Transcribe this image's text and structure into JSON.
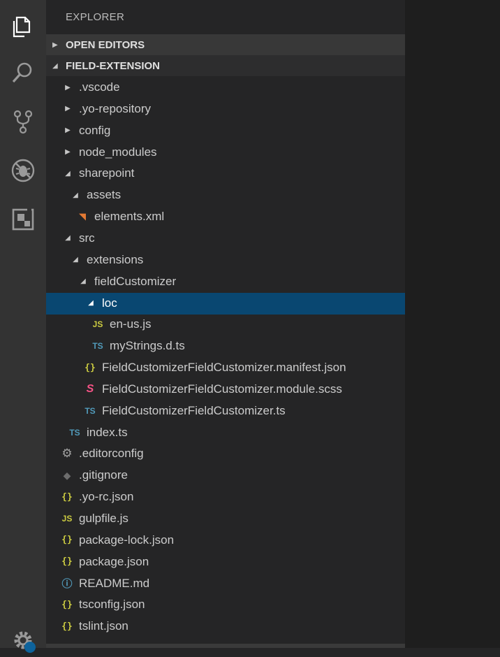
{
  "explorer": {
    "title": "EXPLORER"
  },
  "sections": {
    "open_editors": {
      "label": "OPEN EDITORS",
      "expanded": false
    },
    "project": {
      "label": "FIELD-EXTENSION",
      "expanded": true
    }
  },
  "tree": [
    {
      "label": ".vscode",
      "depth": 0,
      "kind": "folder",
      "expanded": false
    },
    {
      "label": ".yo-repository",
      "depth": 0,
      "kind": "folder",
      "expanded": false
    },
    {
      "label": "config",
      "depth": 0,
      "kind": "folder",
      "expanded": false
    },
    {
      "label": "node_modules",
      "depth": 0,
      "kind": "folder",
      "expanded": false
    },
    {
      "label": "sharepoint",
      "depth": 0,
      "kind": "folder",
      "expanded": true
    },
    {
      "label": "assets",
      "depth": 1,
      "kind": "folder",
      "expanded": true
    },
    {
      "label": "elements.xml",
      "depth": 2,
      "kind": "file",
      "icon": "rss-icon"
    },
    {
      "label": "src",
      "depth": 0,
      "kind": "folder",
      "expanded": true
    },
    {
      "label": "extensions",
      "depth": 1,
      "kind": "folder",
      "expanded": true
    },
    {
      "label": "fieldCustomizer",
      "depth": 2,
      "kind": "folder",
      "expanded": true
    },
    {
      "label": "loc",
      "depth": 3,
      "kind": "folder",
      "expanded": true,
      "selected": true
    },
    {
      "label": "en-us.js",
      "depth": 4,
      "kind": "file",
      "icon": "js-icon"
    },
    {
      "label": "myStrings.d.ts",
      "depth": 4,
      "kind": "file",
      "icon": "ts-icon"
    },
    {
      "label": "FieldCustomizerFieldCustomizer.manifest.json",
      "depth": 3,
      "kind": "file",
      "icon": "json-icon"
    },
    {
      "label": "FieldCustomizerFieldCustomizer.module.scss",
      "depth": 3,
      "kind": "file",
      "icon": "sass-icon"
    },
    {
      "label": "FieldCustomizerFieldCustomizer.ts",
      "depth": 3,
      "kind": "file",
      "icon": "ts-icon"
    },
    {
      "label": "index.ts",
      "depth": 1,
      "kind": "file",
      "icon": "ts-icon"
    },
    {
      "label": ".editorconfig",
      "depth": 0,
      "kind": "file",
      "icon": "gear-icon"
    },
    {
      "label": ".gitignore",
      "depth": 0,
      "kind": "file",
      "icon": "git-icon"
    },
    {
      "label": ".yo-rc.json",
      "depth": 0,
      "kind": "file",
      "icon": "json-icon"
    },
    {
      "label": "gulpfile.js",
      "depth": 0,
      "kind": "file",
      "icon": "js-icon"
    },
    {
      "label": "package-lock.json",
      "depth": 0,
      "kind": "file",
      "icon": "json-icon"
    },
    {
      "label": "package.json",
      "depth": 0,
      "kind": "file",
      "icon": "json-icon"
    },
    {
      "label": "README.md",
      "depth": 0,
      "kind": "file",
      "icon": "info-icon"
    },
    {
      "label": "tsconfig.json",
      "depth": 0,
      "kind": "file",
      "icon": "json-icon"
    },
    {
      "label": "tslint.json",
      "depth": 0,
      "kind": "file",
      "icon": "json-icon"
    }
  ],
  "icon_glyphs": {
    "js-icon": "JS",
    "ts-icon": "TS",
    "json-icon": "{}",
    "rss-icon": "◥",
    "sass-icon": "S",
    "gear-icon": "⚙",
    "git-icon": "◆",
    "info-icon": "ⓘ"
  },
  "activity_bar": [
    "explorer-icon",
    "search-icon",
    "source-control-icon",
    "debug-icon",
    "extensions-icon",
    "settings-icon"
  ],
  "colors": {
    "activity_bar_bg": "#333333",
    "sidebar_bg": "#252526",
    "selection_bg": "#094771",
    "section_header_bg": "#383838"
  }
}
